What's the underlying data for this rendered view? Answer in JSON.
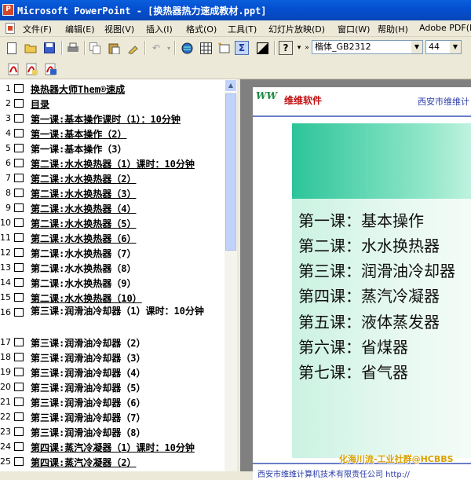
{
  "titlebar": {
    "icon": "P",
    "title": "Microsoft PowerPoint - [换热器热力速成教材.ppt]"
  },
  "menus": [
    "文件(F)",
    "编辑(E)",
    "视图(V)",
    "插入(I)",
    "格式(O)",
    "工具(T)",
    "幻灯片放映(D)",
    "窗口(W)",
    "帮助(H)",
    "Adobe PDF(B)"
  ],
  "toolbar": {
    "font_name": "楷体_GB2312",
    "font_size": "44"
  },
  "outline": [
    {
      "n": "1",
      "text": "换热器大师Them®速成"
    },
    {
      "n": "2",
      "text": "目录"
    },
    {
      "n": "3",
      "text": "第一课:基本操作课时（1）：10分钟"
    },
    {
      "n": "4",
      "text": "第一课:基本操作（2）"
    },
    {
      "n": "5",
      "text": "第一课:基本操作（3）"
    },
    {
      "n": "6",
      "text": "第二课:水水换热器（1）课时：10分钟"
    },
    {
      "n": "7",
      "text": "第二课:水水换热器（2）"
    },
    {
      "n": "8",
      "text": "第二课:水水换热器（3）"
    },
    {
      "n": "9",
      "text": "第二课:水水换热器（4）"
    },
    {
      "n": "10",
      "text": "第二课:水水换热器（5）"
    },
    {
      "n": "11",
      "text": "第二课:水水换热器（6）"
    },
    {
      "n": "12",
      "text": "第二课:水水换热器（7）"
    },
    {
      "n": "13",
      "text": "第二课:水水换热器（8）"
    },
    {
      "n": "14",
      "text": "第二课:水水换热器（9）"
    },
    {
      "n": "15",
      "text": "第二课:水水换热器（10）"
    },
    {
      "n": "16",
      "text": "第三课:润滑油冷却器（1）课时：10分钟"
    },
    {
      "n": "17",
      "text": "第三课:润滑油冷却器（2）"
    },
    {
      "n": "18",
      "text": "第三课:润滑油冷却器（3）"
    },
    {
      "n": "19",
      "text": "第三课:润滑油冷却器（4）"
    },
    {
      "n": "20",
      "text": "第三课:润滑油冷却器（5）"
    },
    {
      "n": "21",
      "text": "第三课:润滑油冷却器（6）"
    },
    {
      "n": "22",
      "text": "第三课:润滑油冷却器（7）"
    },
    {
      "n": "23",
      "text": "第三课:润滑油冷却器（8）"
    },
    {
      "n": "24",
      "text": "第四课:蒸汽冷凝器（1）课时：10分钟"
    },
    {
      "n": "25",
      "text": "第四课:蒸汽冷凝器（2）"
    }
  ],
  "slide": {
    "logo_text": "WW",
    "company": "维维软件",
    "header_right": "西安市维维计",
    "lessons": [
      "第一课：基本操作",
      "第二课：水水换热器",
      "第三课：润滑油冷却器",
      "第四课：蒸汽冷凝器",
      "第五课：液体蒸发器",
      "第六课：省煤器",
      "第七课：省气器"
    ],
    "footer": "西安市维维计算机技术有限责任公司    http://"
  },
  "watermark": "化海川流-工业社群@HCBBS",
  "colors": {
    "titlebar": "#0450d1",
    "slide_band": "#2cc499",
    "company_red": "#c01010"
  }
}
